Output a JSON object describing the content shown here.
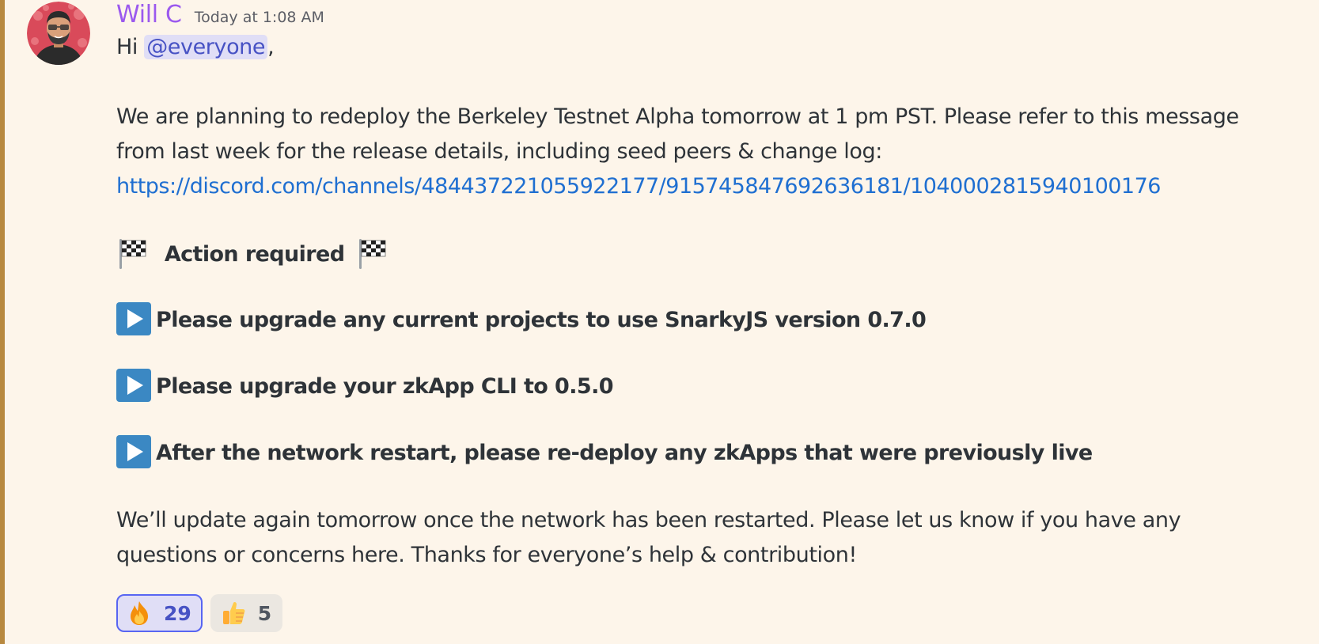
{
  "message": {
    "author": "Will C",
    "timestamp": "Today at 1:08 AM",
    "greeting_prefix": "Hi ",
    "mention": "@everyone",
    "greeting_suffix": ",",
    "paragraph1_line1": "We are planning to redeploy the Berkeley Testnet Alpha tomorrow at 1 pm PST. Please refer to this message",
    "paragraph1_line2": "from last week for the release details, including seed peers & change log:",
    "link": "https://discord.com/channels/484437221055922177/915745847692636181/1040002815940100176",
    "action_heading": "Action required",
    "action_items": [
      "Please upgrade any current projects to use SnarkyJS version 0.7.0",
      "Please upgrade your zkApp CLI to 0.5.0",
      "After the network restart, please re-deploy any zkApps that were previously live"
    ],
    "closing_line1": "We’ll update again tomorrow once the network has been restarted. Please let us know if you have any",
    "closing_line2": "questions or concerns here. Thanks for everyone’s help & contribution!"
  },
  "reactions": [
    {
      "emoji": "fire-icon",
      "count": "29",
      "active": true
    },
    {
      "emoji": "thumbs-up-icon",
      "count": "5",
      "active": false
    }
  ],
  "colors": {
    "background": "#fdf5ea",
    "username": "#9b59ee",
    "link": "#1f6fd1",
    "mention_bg": "#e0def6",
    "mention_text": "#4752c4",
    "highlight_bar": "#b8893f"
  }
}
